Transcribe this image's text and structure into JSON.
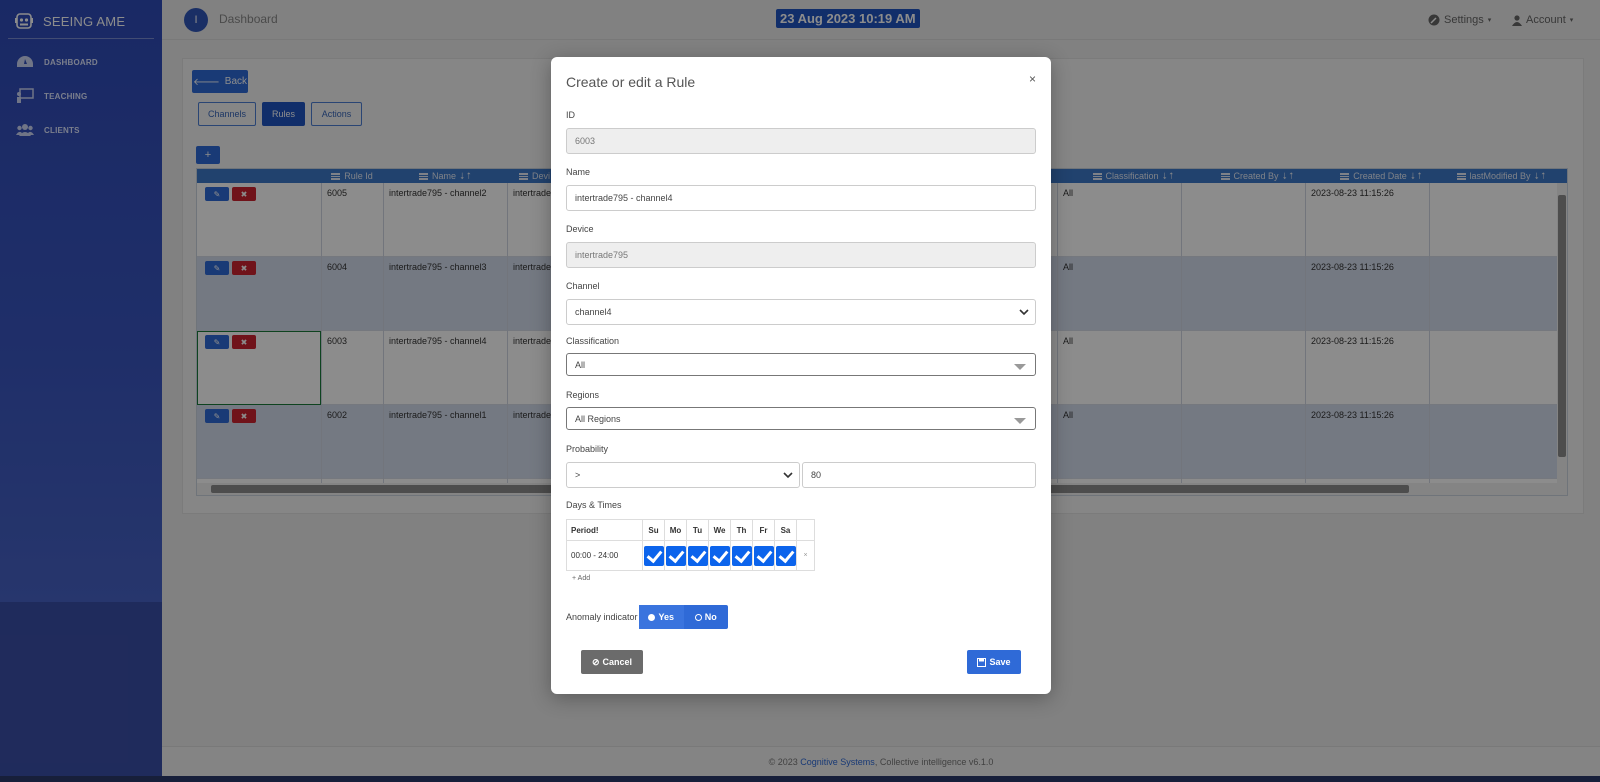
{
  "app": {
    "brand": "SEEING AME"
  },
  "sidebar": {
    "items": [
      {
        "label": "DASHBOARD",
        "icon": "dashboard-icon"
      },
      {
        "label": "TEACHING",
        "icon": "teaching-icon"
      },
      {
        "label": "CLIENTS",
        "icon": "clients-icon"
      }
    ]
  },
  "topbar": {
    "avatar_letter": "I",
    "title": "Dashboard",
    "datetime": "23 Aug 2023 10:19 AM",
    "settings_label": "Settings",
    "account_label": "Account"
  },
  "page": {
    "back_label": "Back",
    "tabs": [
      {
        "label": "Channels",
        "active": false
      },
      {
        "label": "Rules",
        "active": true
      },
      {
        "label": "Actions",
        "active": false
      }
    ],
    "add_label": "+"
  },
  "grid": {
    "headers": [
      "Rule Id",
      "Name",
      "Devi",
      "Classification",
      "Created By",
      "Created Date",
      "lastModified By"
    ],
    "rows": [
      {
        "rule_id": "6005",
        "name": "intertrade795 - channel2",
        "device": "intertrade",
        "classification": "All",
        "created_by": "",
        "created_date": "2023-08-23 11:15:26",
        "last_modified_by": ""
      },
      {
        "rule_id": "6004",
        "name": "intertrade795 - channel3",
        "device": "intertrade",
        "classification": "All",
        "created_by": "",
        "created_date": "2023-08-23 11:15:26",
        "last_modified_by": ""
      },
      {
        "rule_id": "6003",
        "name": "intertrade795 - channel4",
        "device": "intertrade",
        "classification": "All",
        "created_by": "",
        "created_date": "2023-08-23 11:15:26",
        "last_modified_by": ""
      },
      {
        "rule_id": "6002",
        "name": "intertrade795 - channel1",
        "device": "intertrade",
        "classification": "All",
        "created_by": "",
        "created_date": "2023-08-23 11:15:26",
        "last_modified_by": ""
      }
    ]
  },
  "footer": {
    "prefix": "© 2023",
    "company": "Cognitive Systems",
    "suffix": ", Collective intelligence v6.1.0"
  },
  "modal": {
    "title": "Create or edit a Rule",
    "close": "×",
    "id_label": "ID",
    "id_value": "6003",
    "name_label": "Name",
    "name_value": "intertrade795 - channel4",
    "device_label": "Device",
    "device_value": "intertrade795",
    "channel_label": "Channel",
    "channel_value": "channel4",
    "classification_label": "Classification",
    "classification_value": "All",
    "regions_label": "Regions",
    "regions_value": "All Regions",
    "probability_label": "Probability",
    "probability_operator": ">",
    "probability_value": "80",
    "days_label": "Days & Times",
    "period_header": "Period!",
    "days": [
      "Su",
      "Mo",
      "Tu",
      "We",
      "Th",
      "Fr",
      "Sa"
    ],
    "period_value": "00:00 - 24:00",
    "remove_period": "×",
    "add_label": "+ Add",
    "anomaly_label": "Anomaly indicator",
    "anomaly_yes": "Yes",
    "anomaly_no": "No",
    "cancel_label": "Cancel",
    "save_label": "Save"
  },
  "colors": {
    "primary": "#2f6ad7",
    "danger": "#cc2330",
    "sidebar": "#2f4bb8",
    "datetime_bg": "#1f55c2"
  }
}
